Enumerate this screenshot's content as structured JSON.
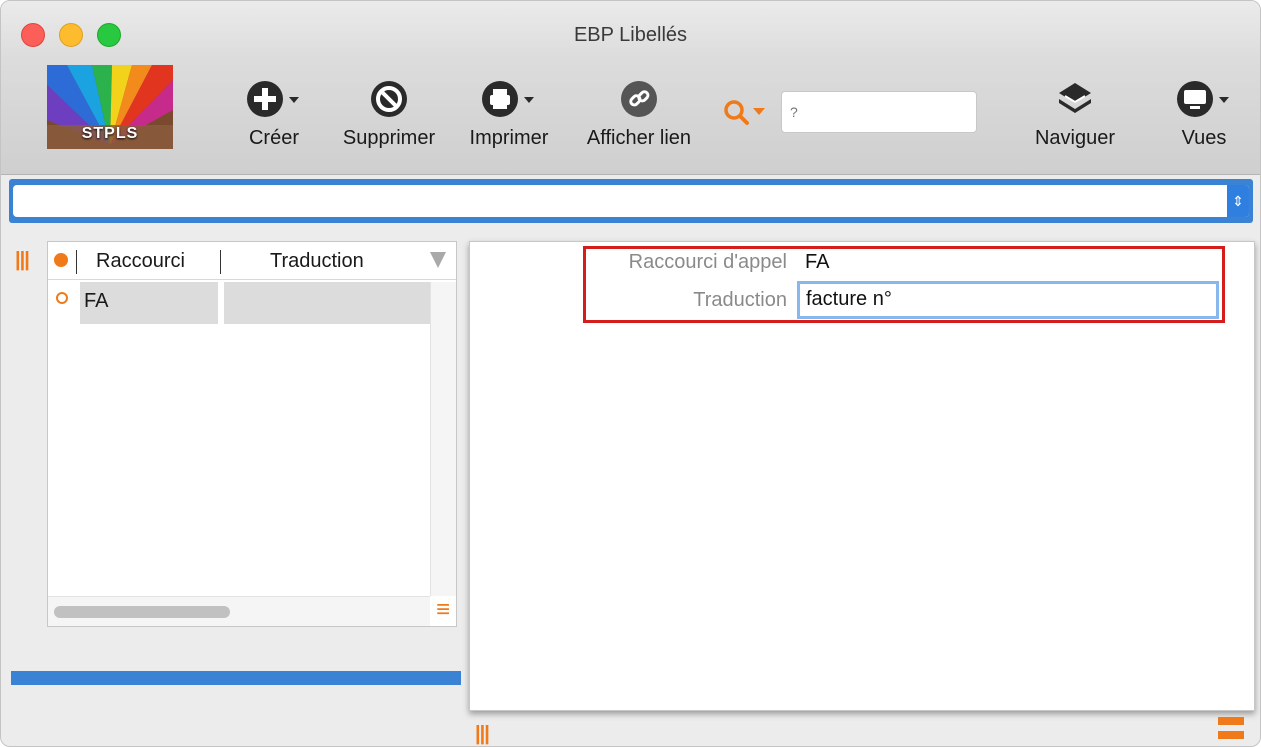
{
  "window": {
    "title": "EBP Libellés"
  },
  "toolbar": {
    "logo_text": "STPLS",
    "buttons": [
      {
        "label": "Créer",
        "icon": "plus-circle-icon"
      },
      {
        "label": "Supprimer",
        "icon": "prohibit-icon"
      },
      {
        "label": "Imprimer",
        "icon": "printer-icon"
      },
      {
        "label": "Afficher lien",
        "icon": "link-icon"
      },
      {
        "label": "Naviguer",
        "icon": "layers-icon"
      },
      {
        "label": "Vues",
        "icon": "monitor-icon"
      }
    ],
    "search": {
      "placeholder": "?"
    }
  },
  "selector": {
    "value": ""
  },
  "list": {
    "columns": [
      "Raccourci",
      "Traduction"
    ],
    "rows": [
      {
        "raccourci": "FA",
        "traduction": ""
      }
    ]
  },
  "detail": {
    "fields": [
      {
        "label": "Raccourci d'appel",
        "value": "FA"
      },
      {
        "label": "Traduction",
        "value": "facture n°"
      }
    ]
  },
  "colors": {
    "accent_orange": "#f07a1a",
    "selector_blue": "#3a82d3",
    "highlight_red": "#d51d1d"
  }
}
